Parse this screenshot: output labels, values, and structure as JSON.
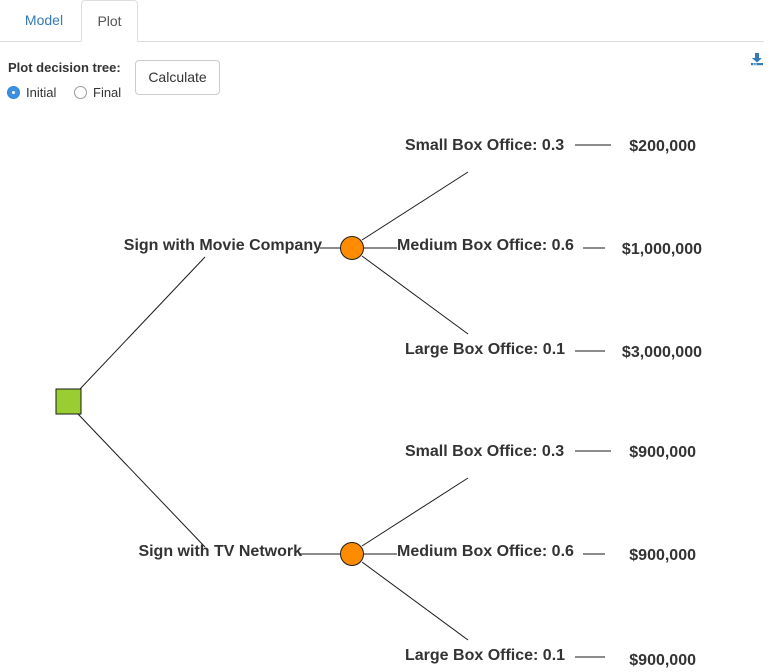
{
  "tabs": [
    {
      "label": "Model",
      "active": false
    },
    {
      "label": "Plot",
      "active": true
    }
  ],
  "controls": {
    "plot_label": "Plot decision tree:",
    "radio_initial": "Initial",
    "radio_final": "Final",
    "selected": "Initial",
    "calculate_label": "Calculate"
  },
  "icons": {
    "download": "download-icon"
  },
  "tree": {
    "root_type": "decision",
    "branches": [
      {
        "label": "Sign with Movie Company",
        "outcomes": [
          {
            "label": "Small Box Office: 0.3",
            "payoff": "$200,000"
          },
          {
            "label": "Medium Box Office: 0.6",
            "payoff": "$1,000,000"
          },
          {
            "label": "Large Box Office: 0.1",
            "payoff": "$3,000,000"
          }
        ]
      },
      {
        "label": "Sign with TV Network",
        "outcomes": [
          {
            "label": "Small Box Office: 0.3",
            "payoff": "$900,000"
          },
          {
            "label": "Medium Box Office: 0.6",
            "payoff": "$900,000"
          },
          {
            "label": "Large Box Office: 0.1",
            "payoff": "$900,000"
          }
        ]
      }
    ]
  },
  "colors": {
    "decision_node": "#9acd32",
    "chance_node": "#ff8c00",
    "link": "#1a1a1a",
    "tab_link": "#337ab7",
    "radio_selected": "#3d8fe3",
    "download_icon": "#337ab7"
  }
}
